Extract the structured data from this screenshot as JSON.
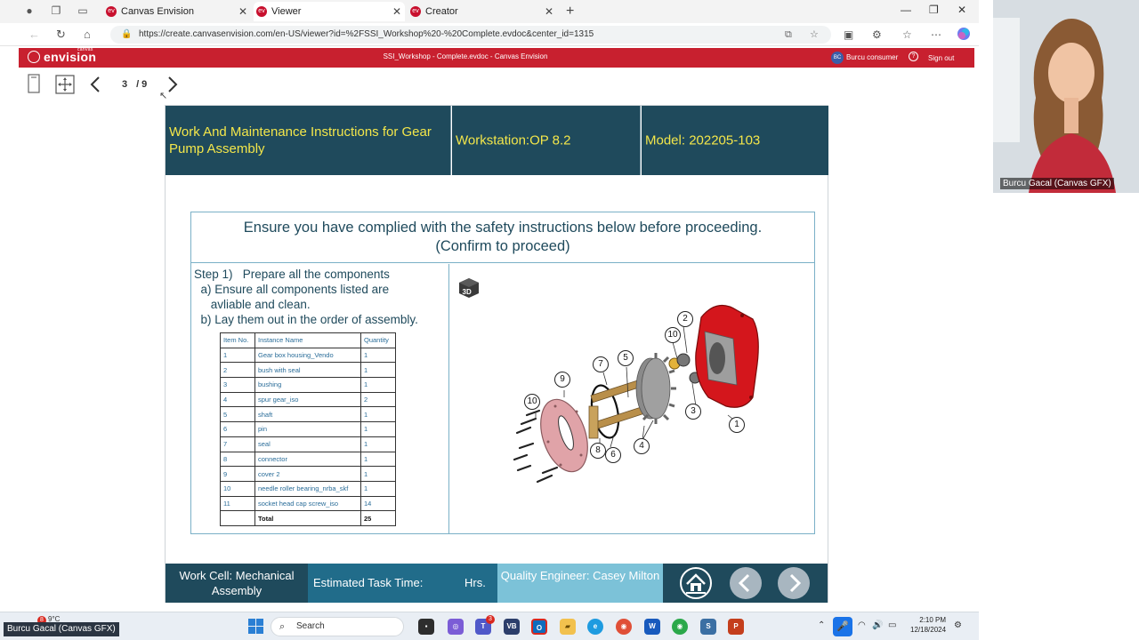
{
  "browser": {
    "tabs": [
      {
        "label": "Canvas Envision",
        "active": false
      },
      {
        "label": "Viewer",
        "active": true
      },
      {
        "label": "Creator",
        "active": false
      }
    ],
    "url": "https://create.canvasenvision.com/en-US/viewer?id=%2FSSI_Workshop%20-%20Complete.evdoc&center_id=1315"
  },
  "app": {
    "logo_text": "envision",
    "logo_sup": "canvas",
    "title": "SSI_Workshop - Complete.evdoc - Canvas Envision",
    "user_initials": "BC",
    "user_name": "Burcu consumer",
    "signout": "Sign out"
  },
  "viewer": {
    "current_page": "3",
    "total_pages": "/ 9"
  },
  "document": {
    "header": {
      "title": "Work And Maintenance Instructions for Gear Pump Assembly",
      "workstation": "Workstation:OP 8.2",
      "model": "Model: 202205-103"
    },
    "safety_line1": "Ensure you have complied with the safety instructions below before proceeding.",
    "safety_line2": "(Confirm to proceed)",
    "steps": [
      "Step 1)   Prepare all the components",
      "  a) Ensure all components listed are",
      "     avliable and clean.",
      "  b) Lay them out in the order of assembly."
    ],
    "parts_table": {
      "headers": [
        "Item No.",
        "Instance Name",
        "Quantity"
      ],
      "rows": [
        [
          "1",
          "Gear box housing_Vendo",
          "1"
        ],
        [
          "2",
          "bush with seal",
          "1"
        ],
        [
          "3",
          "bushing",
          "1"
        ],
        [
          "4",
          "spur gear_iso",
          "2"
        ],
        [
          "5",
          "shaft",
          "1"
        ],
        [
          "6",
          "pin",
          "1"
        ],
        [
          "7",
          "seal",
          "1"
        ],
        [
          "8",
          "connector",
          "1"
        ],
        [
          "9",
          "cover 2",
          "1"
        ],
        [
          "10",
          "needle roller bearing_nrba_skf",
          "1"
        ],
        [
          "11",
          "socket head cap screw_iso",
          "14"
        ]
      ],
      "total_label": "Total",
      "total_value": "25"
    },
    "callouts": [
      "1",
      "2",
      "3",
      "4",
      "5",
      "6",
      "7",
      "8",
      "9",
      "10",
      "10"
    ],
    "footer": {
      "work_cell": "Work Cell: Mechanical Assembly",
      "task_time_label": "Estimated Task Time:",
      "task_time_unit": "Hrs.",
      "quality_engineer": "Quality Engineer: Casey Milton"
    }
  },
  "webcam": {
    "name": "Burcu Gacal (Canvas GFX)"
  },
  "taskbar": {
    "weather_badge": "8",
    "weather_temp": "9°C",
    "presenter_label": "Burcu Gacal (Canvas GFX)",
    "search_placeholder": "Search",
    "teams_badge": "3",
    "time": "2:10 PM",
    "date": "12/18/2024"
  },
  "colors": {
    "brand_red": "#c8202f",
    "doc_header": "#1f4a5c",
    "doc_header_text": "#f3e64a",
    "footer_mid": "#216c8a",
    "footer_light": "#7cc2d8",
    "pump_red": "#d4161c"
  }
}
